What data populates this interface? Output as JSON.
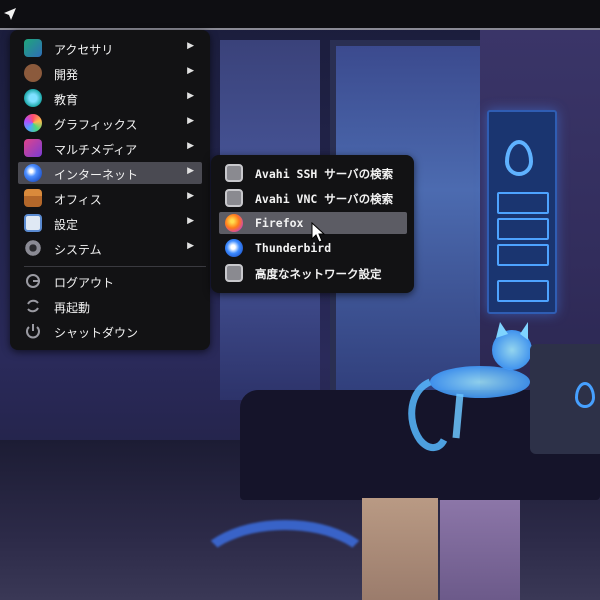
{
  "topbar": {
    "launcher_icon": "paper-plane-icon"
  },
  "main_menu": {
    "items": [
      {
        "label": "アクセサリ",
        "icon": "accessories-icon",
        "has_submenu": true
      },
      {
        "label": "開発",
        "icon": "development-icon",
        "has_submenu": true
      },
      {
        "label": "教育",
        "icon": "education-icon",
        "has_submenu": true
      },
      {
        "label": "グラフィックス",
        "icon": "graphics-icon",
        "has_submenu": true
      },
      {
        "label": "マルチメディア",
        "icon": "multimedia-icon",
        "has_submenu": true
      },
      {
        "label": "インターネット",
        "icon": "internet-icon",
        "has_submenu": true,
        "active": true
      },
      {
        "label": "オフィス",
        "icon": "office-icon",
        "has_submenu": true
      },
      {
        "label": "設定",
        "icon": "settings-icon",
        "has_submenu": true
      },
      {
        "label": "システム",
        "icon": "system-icon",
        "has_submenu": true
      }
    ],
    "actions": [
      {
        "label": "ログアウト",
        "icon": "logout-icon"
      },
      {
        "label": "再起動",
        "icon": "restart-icon"
      },
      {
        "label": "シャットダウン",
        "icon": "shutdown-icon"
      }
    ],
    "arrow_glyph": "▶"
  },
  "internet_submenu": {
    "items": [
      {
        "label": "Avahi SSH サーバの検索",
        "icon": "network-server-icon"
      },
      {
        "label": "Avahi VNC サーバの検索",
        "icon": "network-server-icon"
      },
      {
        "label": "Firefox",
        "icon": "firefox-icon",
        "hovered": true
      },
      {
        "label": "Thunderbird",
        "icon": "thunderbird-icon"
      },
      {
        "label": "高度なネットワーク設定",
        "icon": "network-settings-icon"
      }
    ]
  },
  "colors": {
    "menu_bg": "#121214",
    "active_bg": "#4a4a52",
    "hover_bg": "#5c5c64",
    "text": "#f2f2f2"
  }
}
